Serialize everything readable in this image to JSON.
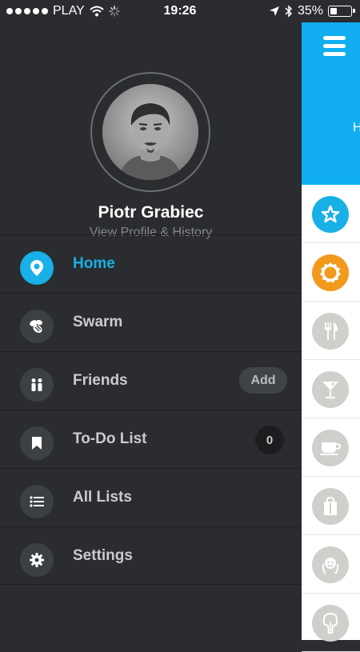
{
  "status_bar": {
    "carrier": "PLAY",
    "time": "19:26",
    "battery": "35%",
    "battery_level": 0.35
  },
  "profile": {
    "name": "Piotr Grabiec",
    "subtitle": "View Profile & History"
  },
  "menu": {
    "items": [
      {
        "label": "Home",
        "icon": "location-pin-icon",
        "active": true
      },
      {
        "label": "Swarm",
        "icon": "bee-icon"
      },
      {
        "label": "Friends",
        "icon": "friends-icon",
        "action": "Add"
      },
      {
        "label": "To-Do List",
        "icon": "bookmark-icon",
        "count": "0"
      },
      {
        "label": "All Lists",
        "icon": "list-icon"
      },
      {
        "label": "Settings",
        "icon": "gear-icon"
      }
    ]
  },
  "peek": {
    "header_text": "H",
    "categories": [
      "star-icon",
      "badge-icon",
      "fork-knife-icon",
      "cocktail-icon",
      "coffee-cup-icon",
      "shopping-bag-icon",
      "smiley-person-icon",
      "tree-icon"
    ]
  },
  "colors": {
    "accent": "#18b0e6",
    "drawer_bg": "#2a2c2f",
    "header_blue": "#10aef0",
    "orange": "#f29a1c"
  }
}
